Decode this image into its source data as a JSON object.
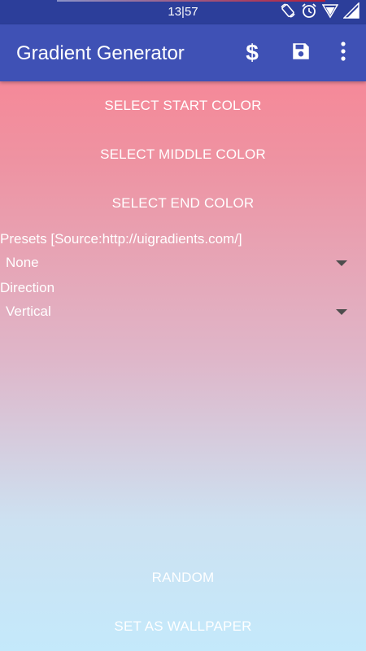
{
  "status_bar": {
    "time": "13|57",
    "icons": [
      "rotate-icon",
      "alarm-icon",
      "wifi-icon",
      "signal-icon"
    ]
  },
  "app_bar": {
    "title": "Gradient Generator",
    "actions": {
      "donate": "$",
      "save_icon": "save-icon",
      "more_icon": "more-vert-icon"
    }
  },
  "buttons": {
    "start_color": "SELECT START COLOR",
    "middle_color": "SELECT MIDDLE COLOR",
    "end_color": "SELECT END COLOR",
    "random": "RANDOM",
    "set_wallpaper": "SET AS WALLPAPER"
  },
  "presets": {
    "label": "Presets [Source:http://uigradients.com/]",
    "selected": "None"
  },
  "direction": {
    "label": "Direction",
    "selected": "Vertical"
  },
  "colors": {
    "status_bar": "#2c3e9a",
    "app_bar": "#3f51b5",
    "gradient_start": "#fd7f8f",
    "gradient_end": "#c4e9fb"
  }
}
